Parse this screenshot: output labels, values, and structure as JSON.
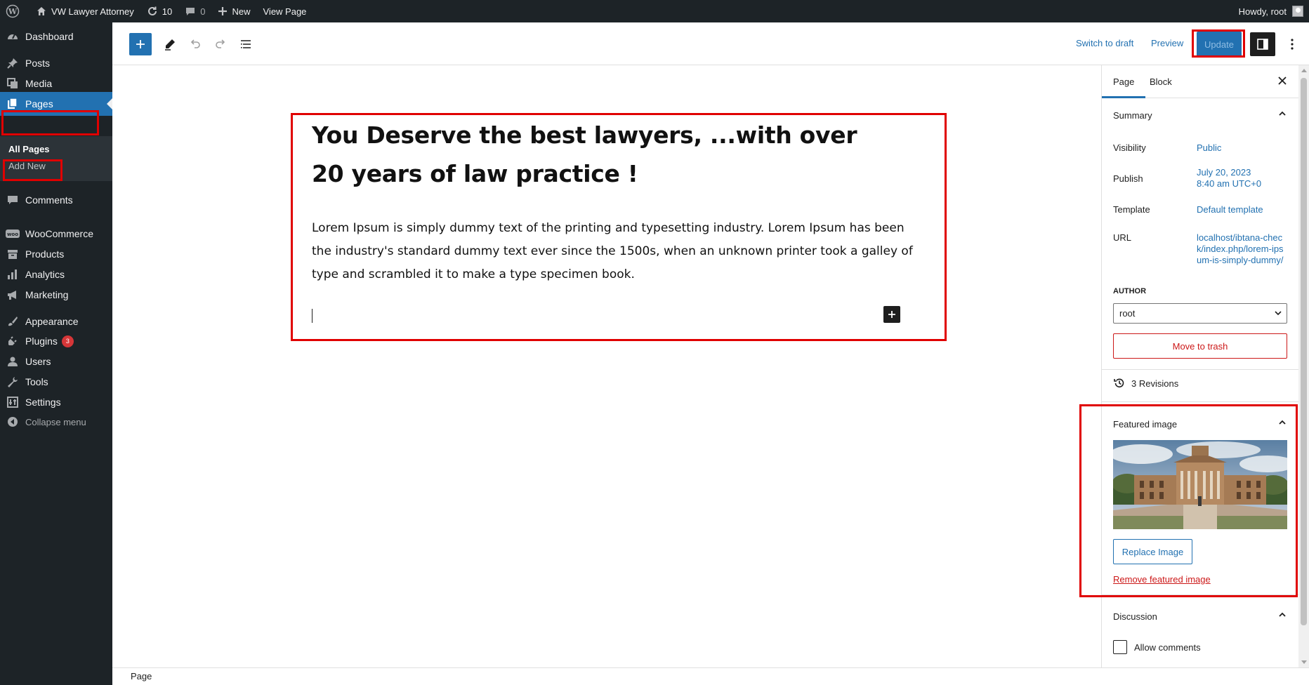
{
  "adminbar": {
    "site_name": "VW Lawyer Attorney",
    "updates_count": "10",
    "comments_count": "0",
    "new_label": "New",
    "view_page_label": "View Page",
    "howdy": "Howdy, root"
  },
  "menu": {
    "dashboard": "Dashboard",
    "posts": "Posts",
    "media": "Media",
    "pages": "Pages",
    "all_pages": "All Pages",
    "add_new": "Add New",
    "comments": "Comments",
    "woocommerce": "WooCommerce",
    "products": "Products",
    "analytics": "Analytics",
    "marketing": "Marketing",
    "appearance": "Appearance",
    "plugins": "Plugins",
    "plugins_badge": "3",
    "users": "Users",
    "tools": "Tools",
    "settings": "Settings",
    "collapse": "Collapse menu"
  },
  "header": {
    "switch_to_draft": "Switch to draft",
    "preview": "Preview",
    "update": "Update"
  },
  "content": {
    "title": "You Deserve the best lawyers, ...with over 20 years of law practice !",
    "paragraph": "Lorem Ipsum is simply dummy text of the printing and typesetting industry. Lorem Ipsum has been the industry's standard dummy text ever since the 1500s, when an unknown printer took a galley of type and scrambled it to make a type specimen book."
  },
  "footer": {
    "breadcrumb": "Page"
  },
  "sidebar": {
    "tab_page": "Page",
    "tab_block": "Block",
    "summary_title": "Summary",
    "visibility_label": "Visibility",
    "visibility_value": "Public",
    "publish_label": "Publish",
    "publish_date": "July 20, 2023",
    "publish_time": "8:40 am UTC+0",
    "template_label": "Template",
    "template_value": "Default template",
    "url_label": "URL",
    "url_value": "localhost/ibtana-check/index.php/lorem-ipsum-is-simply-dummy/",
    "author_label": "AUTHOR",
    "author_value": "root",
    "move_to_trash": "Move to trash",
    "revisions": "3 Revisions",
    "featured_title": "Featured image",
    "replace_image": "Replace Image",
    "remove_featured": "Remove featured image",
    "discussion_title": "Discussion",
    "allow_comments": "Allow comments"
  },
  "colors": {
    "admin_dark": "#1d2327",
    "accent": "#2271b1",
    "danger": "#cc1818",
    "highlight": "#e00000"
  }
}
